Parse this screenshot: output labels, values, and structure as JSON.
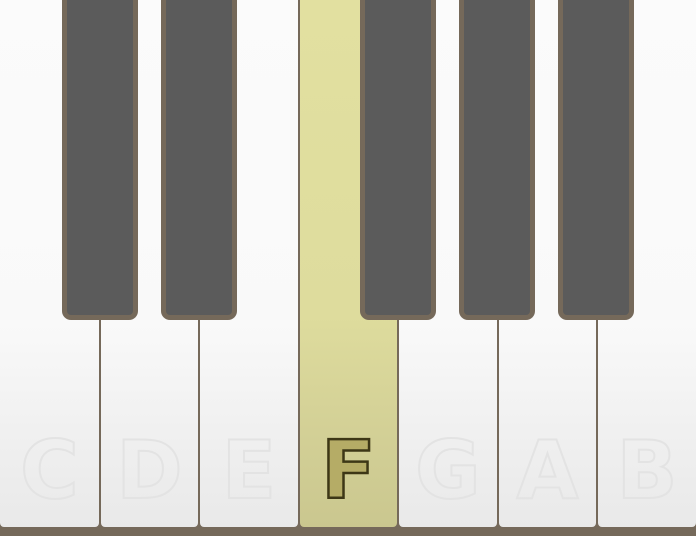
{
  "keyboard": {
    "active_note": "F",
    "white_keys": [
      "C",
      "D",
      "E",
      "F",
      "G",
      "A",
      "B"
    ],
    "black_keys": [
      "C#",
      "D#",
      "F#",
      "G#",
      "A#"
    ],
    "colors": {
      "frame": "#75695a",
      "white_key": "#f9f9f9",
      "black_key": "#5b5b5b",
      "highlight": "#dedc9d",
      "label_outline": "#e3e3e3",
      "active_label_fill": "#b5ac66",
      "active_label_outline": "#3d3716"
    }
  }
}
